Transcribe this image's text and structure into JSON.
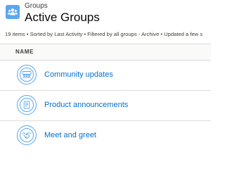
{
  "colors": {
    "accent": "#5aa7f0",
    "link": "#0070d2"
  },
  "header": {
    "icon": "groups-icon",
    "eyebrow": "Groups",
    "title": "Active Groups"
  },
  "meta_text": "19 items • Sorted by Last Activity • Filtered by all groups - Archive • Updated a few s",
  "table": {
    "column_header": "NAME",
    "rows": [
      {
        "label": "Community updates",
        "icon": "group-people-icon"
      },
      {
        "label": "Product announcements",
        "icon": "document-icon"
      },
      {
        "label": "Meet and greet",
        "icon": "handshake-icon"
      }
    ]
  }
}
